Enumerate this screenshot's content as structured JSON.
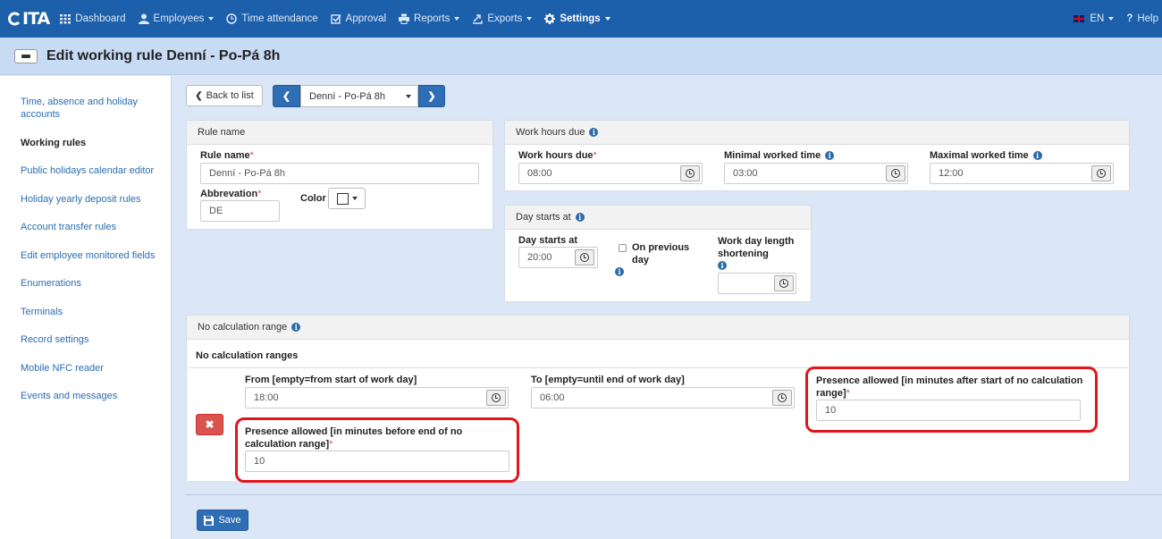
{
  "nav": {
    "logo": "ITA",
    "items": [
      {
        "label": "Dashboard",
        "icon": "grid-icon"
      },
      {
        "label": "Employees",
        "icon": "user-icon",
        "dropdown": true
      },
      {
        "label": "Time attendance",
        "icon": "clock-icon"
      },
      {
        "label": "Approval",
        "icon": "check-edit-icon"
      },
      {
        "label": "Reports",
        "icon": "print-icon",
        "dropdown": true
      },
      {
        "label": "Exports",
        "icon": "export-icon",
        "dropdown": true
      },
      {
        "label": "Settings",
        "icon": "gear-icon",
        "dropdown": true,
        "active": true
      }
    ],
    "language": "EN",
    "help": "Help"
  },
  "page": {
    "title": "Edit working rule Denní - Po-Pá 8h"
  },
  "sidebar": {
    "items": [
      {
        "label": "Time, absence and holiday accounts"
      },
      {
        "label": "Working rules",
        "active": true
      },
      {
        "label": "Public holidays calendar editor"
      },
      {
        "label": "Holiday yearly deposit rules"
      },
      {
        "label": "Account transfer rules"
      },
      {
        "label": "Edit employee monitored fields"
      },
      {
        "label": "Enumerations"
      },
      {
        "label": "Terminals"
      },
      {
        "label": "Record settings"
      },
      {
        "label": "Mobile NFC reader"
      },
      {
        "label": "Events and messages"
      }
    ]
  },
  "toolbar": {
    "back_label": "Back to list",
    "selected_rule": "Denní - Po-Pá 8h"
  },
  "rule_name_panel": {
    "header": "Rule name",
    "rule_name_label": "Rule name",
    "rule_name_value": "Denní - Po-Pá 8h",
    "abbrev_label": "Abbrevation",
    "abbrev_value": "DE",
    "color_label": "Color"
  },
  "work_hours_panel": {
    "header": "Work hours due",
    "due_label": "Work hours due",
    "due_value": "08:00",
    "min_label": "Minimal worked time",
    "min_value": "03:00",
    "max_label": "Maximal worked time",
    "max_value": "12:00"
  },
  "day_start_panel": {
    "header": "Day starts at",
    "start_label": "Day starts at",
    "start_value": "20:00",
    "prev_day_label_1": "On previous",
    "prev_day_label_2": "day",
    "shortening_label_1": "Work day length",
    "shortening_label_2": "shortening",
    "shortening_value": ""
  },
  "no_calc_panel": {
    "header": "No calculation range",
    "subheader": "No calculation ranges",
    "from_label": "From [empty=from start of work day]",
    "from_value": "18:00",
    "to_label": "To [empty=until end of work day]",
    "to_value": "06:00",
    "after_label_1": "Presence allowed [in minutes after start of no calculation",
    "after_label_2": "range]",
    "after_value": "10",
    "before_label_1": "Presence allowed [in minutes before end of no",
    "before_label_2": "calculation range]",
    "before_value": "10"
  },
  "save_label": "Save",
  "colors": {
    "nav": "#1c5fab",
    "accent": "#2f6db5",
    "highlight": "#e0161e",
    "delete": "#d9534f"
  }
}
